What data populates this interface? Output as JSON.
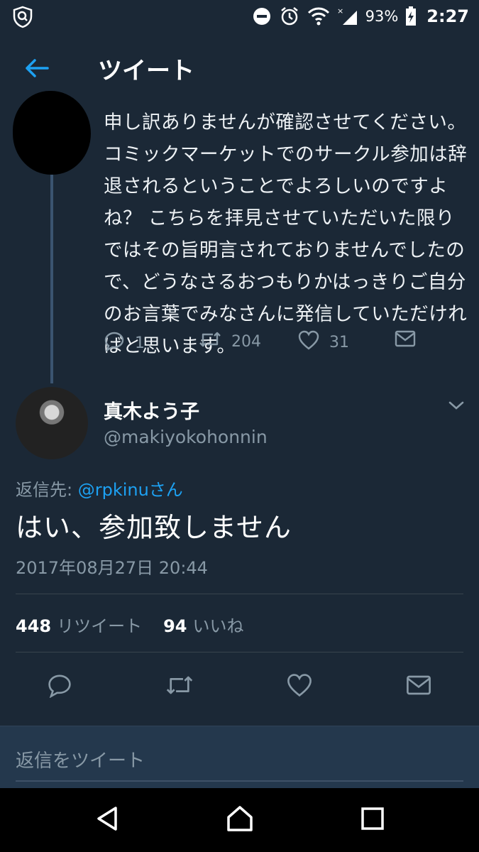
{
  "status_bar": {
    "battery": "93%",
    "time": "2:27",
    "icons": [
      "shield-search-icon",
      "do-not-disturb-icon",
      "alarm-icon",
      "wifi-icon",
      "signal-icon",
      "battery-charging-icon"
    ]
  },
  "app_bar": {
    "title": "ツイート",
    "back_icon": "arrow-left-icon"
  },
  "previous_tweet": {
    "text": "申し訳ありませんが確認させてください。コミックマーケットでのサークル参加は辞退されるということでよろしいのですよね？ こちらを拝見させていただいた限りではその旨明言されておりませんでしたので、どうなさるおつもりかはっきりご自分のお言葉でみなさんに発信していただければと思います。",
    "reply_count": "1",
    "retweet_count": "204",
    "like_count": "31"
  },
  "main_tweet": {
    "author_name": "真木よう子",
    "author_handle": "@makiyokohonnin",
    "reply_to_label": "返信先: ",
    "reply_to_mention": "@rpkinuさん",
    "text": "はい、参加致しません",
    "timestamp": "2017年08月27日 20:44",
    "retweets": "448",
    "retweets_label": "リツイート",
    "likes": "94",
    "likes_label": "いいね"
  },
  "reply_box": {
    "placeholder": "返信をツイート"
  },
  "colors": {
    "background": "#1b2836",
    "accent": "#1da1f2",
    "muted": "#8899a6"
  }
}
